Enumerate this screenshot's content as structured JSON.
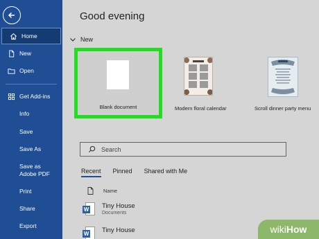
{
  "sidebar": {
    "back_icon": "back-arrow-icon",
    "items": [
      {
        "label": "Home",
        "icon": "home-icon"
      },
      {
        "label": "New",
        "icon": "new-doc-icon"
      },
      {
        "label": "Open",
        "icon": "folder-icon"
      },
      {
        "label": "Get Add-ins",
        "icon": "grid-icon"
      },
      {
        "label": "Info"
      },
      {
        "label": "Save"
      },
      {
        "label": "Save As"
      },
      {
        "label": "Save as Adobe PDF"
      },
      {
        "label": "Print"
      },
      {
        "label": "Share"
      },
      {
        "label": "Export"
      }
    ]
  },
  "main": {
    "greeting": "Good evening",
    "new_section": "New",
    "templates": [
      {
        "label": "Blank document"
      },
      {
        "label": "Modern floral calendar"
      },
      {
        "label": "Scroll dinner party menu"
      }
    ],
    "search_placeholder": "Search",
    "tabs": [
      "Recent",
      "Pinned",
      "Shared with Me"
    ],
    "list_header": "Name",
    "files": [
      {
        "name": "Tiny House",
        "location": "Documents"
      },
      {
        "name": "Tiny House",
        "location": ""
      }
    ]
  },
  "watermark": {
    "prefix": "wiki",
    "suffix": "How"
  },
  "colors": {
    "sidebar": "#1f4e94",
    "highlight": "#22dd22"
  }
}
